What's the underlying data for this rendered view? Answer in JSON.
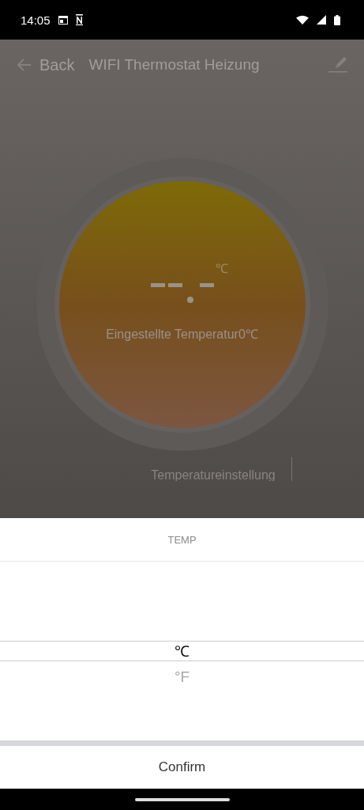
{
  "status_bar": {
    "time": "14:05"
  },
  "header": {
    "back": "Back",
    "title": "WIFI Thermostat Heizung"
  },
  "dial": {
    "unit": "℃",
    "set_label": "Eingestellte Temperatur0℃"
  },
  "section_label": "Temperatureinstellung",
  "picker": {
    "title": "TEMP",
    "options": [
      {
        "label": "℃",
        "selected": true
      },
      {
        "label": "°F",
        "selected": false
      }
    ],
    "confirm": "Confirm"
  }
}
